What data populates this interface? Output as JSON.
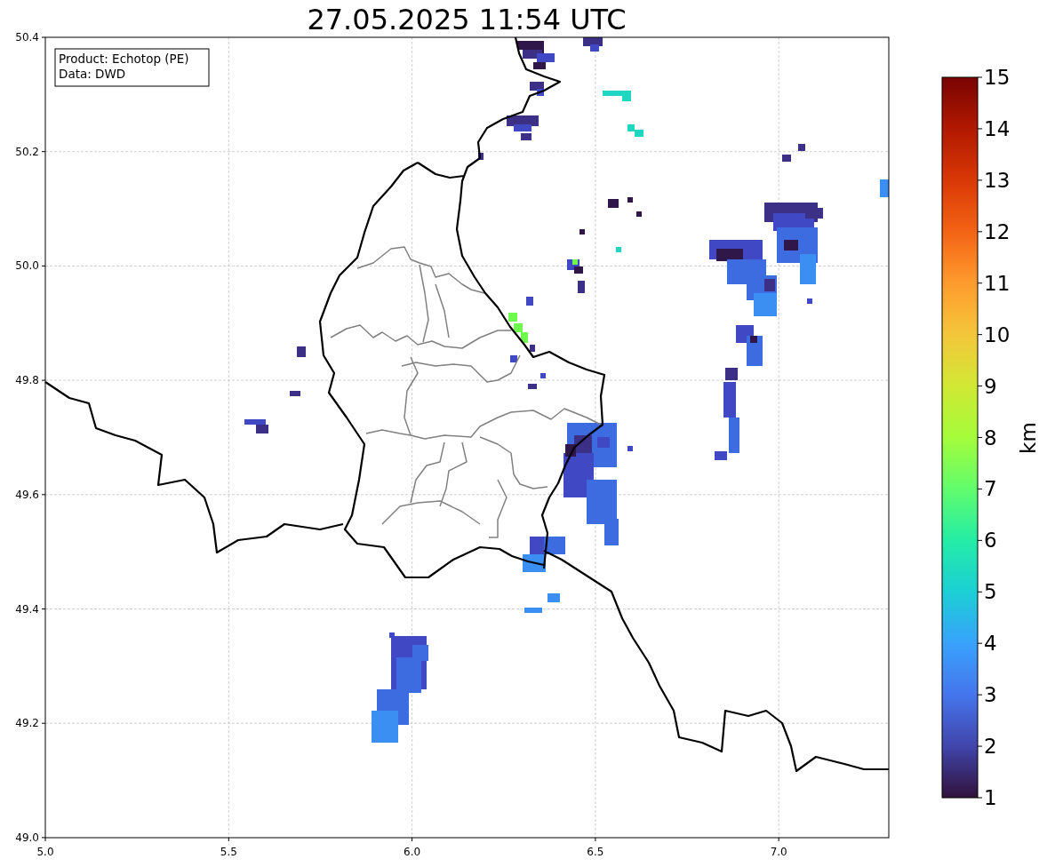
{
  "title": "27.05.2025 11:54 UTC",
  "legend_box": {
    "lines": [
      "Product: Echotop (PE)",
      "Data: DWD"
    ]
  },
  "map": {
    "x_ticks": [
      "5.0",
      "5.5",
      "6.0",
      "6.5",
      "7.0"
    ],
    "y_ticks": [
      "50.4",
      "50.2",
      "50.0",
      "49.8",
      "49.6",
      "49.4",
      "49.2",
      "49.0"
    ]
  },
  "colorbar": {
    "ticks": [
      "15",
      "14",
      "13",
      "12",
      "11",
      "10",
      "9",
      "8",
      "7",
      "6",
      "5",
      "4",
      "3",
      "2",
      "1"
    ],
    "label": "km"
  }
}
